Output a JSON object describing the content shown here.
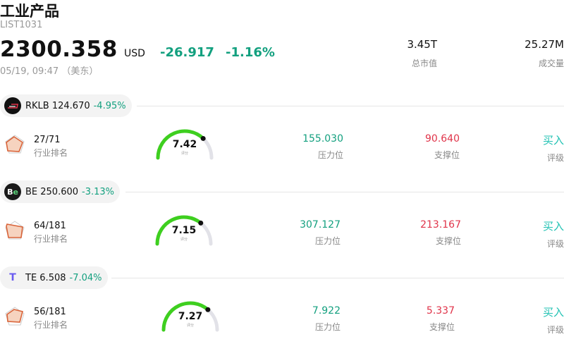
{
  "header": {
    "title": "工业产品",
    "code": "LIST1031",
    "price": "2300.358",
    "currency": "USD",
    "change": "-26.917",
    "change_pct": "-1.16%",
    "time": "05/19, 09:47 （美东）",
    "market_cap_value": "3.45T",
    "market_cap_label": "总市值",
    "volume_value": "25.27M",
    "volume_label": "成交量"
  },
  "colors": {
    "up_down_green": "#13a07f",
    "support_red": "#e0344a",
    "rating_teal": "#20c2b3",
    "gauge_green": "#3ecf1f"
  },
  "stocks": [
    {
      "logo_icon": "rklb-logo-icon",
      "symbol_price": "RKLB 124.670",
      "pct": "-4.95%",
      "rank": "27/71",
      "rank_label": "行业排名",
      "score": "7.42",
      "score_label": "评分",
      "score_fraction": 0.742,
      "resistance": "155.030",
      "resistance_label": "压力位",
      "support": "90.640",
      "support_label": "支撑位",
      "rating": "买入",
      "rating_label": "评级"
    },
    {
      "logo_icon": "be-logo-icon",
      "symbol_price": "BE 250.600",
      "pct": "-3.13%",
      "rank": "64/181",
      "rank_label": "行业排名",
      "score": "7.15",
      "score_label": "评分",
      "score_fraction": 0.715,
      "resistance": "307.127",
      "resistance_label": "压力位",
      "support": "213.167",
      "support_label": "支撑位",
      "rating": "买入",
      "rating_label": "评级"
    },
    {
      "logo_icon": "te-logo-icon",
      "symbol_price": "TE 6.508",
      "pct": "-7.04%",
      "rank": "56/181",
      "rank_label": "行业排名",
      "score": "7.27",
      "score_label": "评分",
      "score_fraction": 0.727,
      "resistance": "7.922",
      "resistance_label": "压力位",
      "support": "5.337",
      "support_label": "支撑位",
      "rating": "买入",
      "rating_label": "评级"
    }
  ]
}
